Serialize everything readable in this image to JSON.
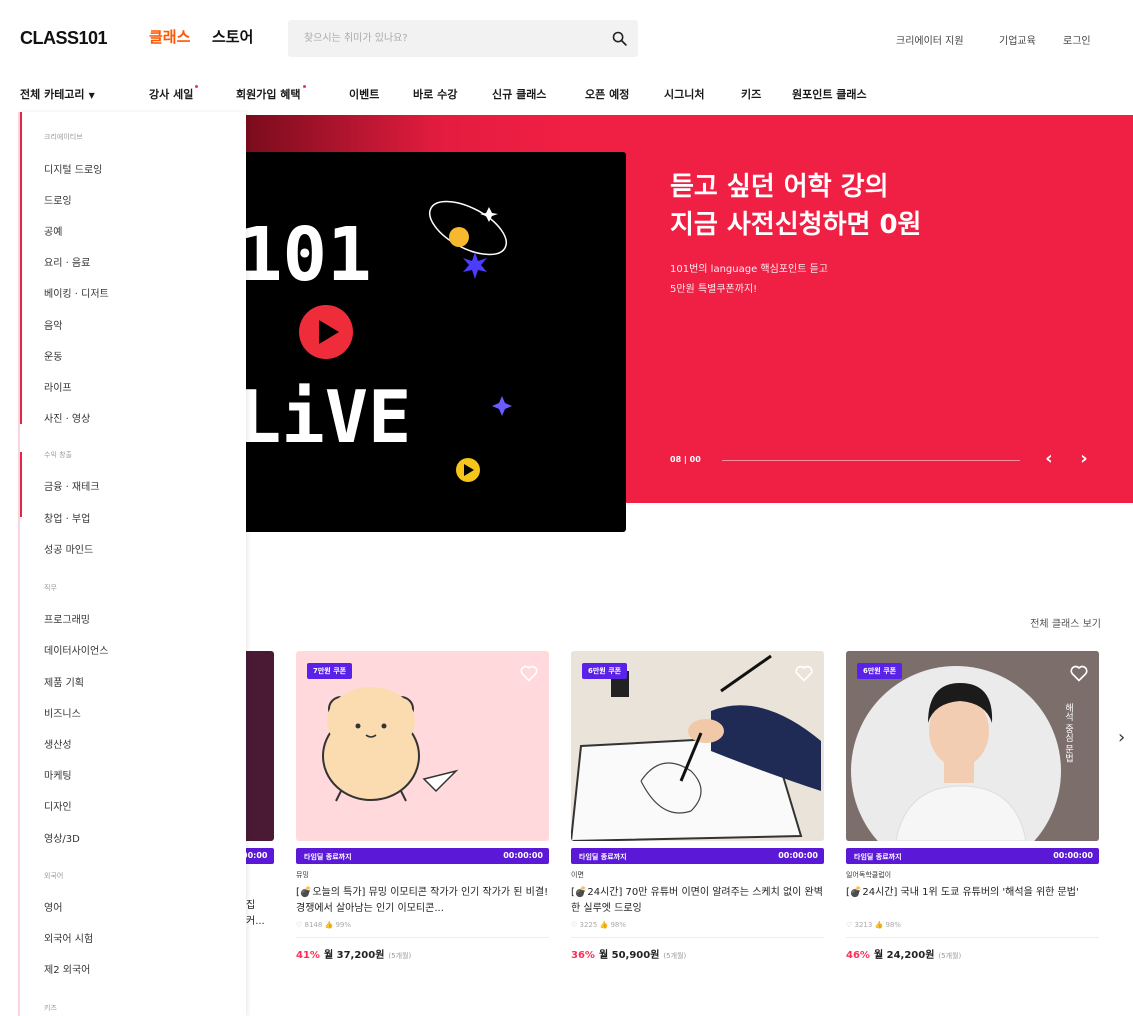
{
  "header": {
    "logo": "CLASS101",
    "tabs": [
      "클래스",
      "스토어"
    ],
    "search_placeholder": "찾으시는 취미가 있나요?",
    "links": [
      "크리에이터 지원",
      "기업교육",
      "로그인"
    ]
  },
  "nav": {
    "all_categories": "전체 카테고리",
    "items": [
      "강사 세일",
      "회원가입 혜택",
      "이벤트",
      "바로 수강",
      "신규 클래스",
      "오픈 예정",
      "시그니처",
      "키즈",
      "원포인트 클래스"
    ]
  },
  "dropdown": {
    "groups": [
      {
        "label": "크리에이티브",
        "items": [
          "디지털 드로잉",
          "드로잉",
          "공예",
          "요리 · 음료",
          "베이킹 · 디저트",
          "음악",
          "운동",
          "라이프",
          "사진 · 영상"
        ]
      },
      {
        "label": "수익 창출",
        "items": [
          "금융 · 재테크",
          "창업 · 부업",
          "성공 마인드"
        ]
      },
      {
        "label": "직무",
        "items": [
          "프로그래밍",
          "데이터사이언스",
          "제품 기획",
          "비즈니스",
          "생산성",
          "마케팅",
          "디자인",
          "영상/3D"
        ]
      },
      {
        "label": "외국어",
        "items": [
          "영어",
          "외국어 시험",
          "제2 외국어"
        ]
      },
      {
        "label": "키즈",
        "items": []
      }
    ]
  },
  "hero": {
    "title_line1": "듣고 싶던 어학 강의",
    "title_line2": "지금 사전신청하면 0원",
    "sub_line1": "101번의 language 핵심포인트 듣고",
    "sub_line2": "5만원 특별쿠폰까지!",
    "counter": "08 | 00",
    "prev": "‹",
    "next": "›",
    "image_text_1": "101",
    "image_text_2": "LiVE"
  },
  "classes": {
    "see_all": "전체 클래스 보기",
    "partial": {
      "timer": "00:00",
      "title1": "집",
      "title2": "커..."
    },
    "cards": [
      {
        "coupon": "7만원 쿠폰",
        "timer_label": "타임딜 종료까지",
        "timer": "00:00:00",
        "creator": "뮤밍",
        "title": "[💣오늘의 특가] 뮤밍 이모티콘 작가가 인기 작가가 된 비결! 경쟁에서 살아남는 인기 이모티콘...",
        "stats": "♡ 8148  👍 99%",
        "discount": "41%",
        "price": "월 37,200원",
        "months": "(5개월)"
      },
      {
        "coupon": "6만원 쿠폰",
        "timer_label": "타임딜 종료까지",
        "timer": "00:00:00",
        "creator": "이면",
        "title": "[💣24시간] 70만 유튜버 이면이 알려주는 스케치 없이 완벽한 실루엣 드로잉",
        "stats": "♡ 3225  👍 98%",
        "discount": "36%",
        "price": "월 50,900원",
        "months": "(5개월)"
      },
      {
        "coupon": "6만원 쿠폰",
        "timer_label": "타임딜 종료까지",
        "timer": "00:00:00",
        "creator": "일어독학클럽이",
        "title": "[💣24시간] 국내 1위 도쿄 유튜버의 '해석을 위한 문법'",
        "stats": "♡ 3213  👍 98%",
        "discount": "46%",
        "price": "월 24,200원",
        "months": "(5개월)"
      }
    ]
  },
  "colors": {
    "accent": "#ff5600",
    "hero": "#f01f44",
    "deal": "#5b18d6",
    "discount": "#ff2d55"
  }
}
